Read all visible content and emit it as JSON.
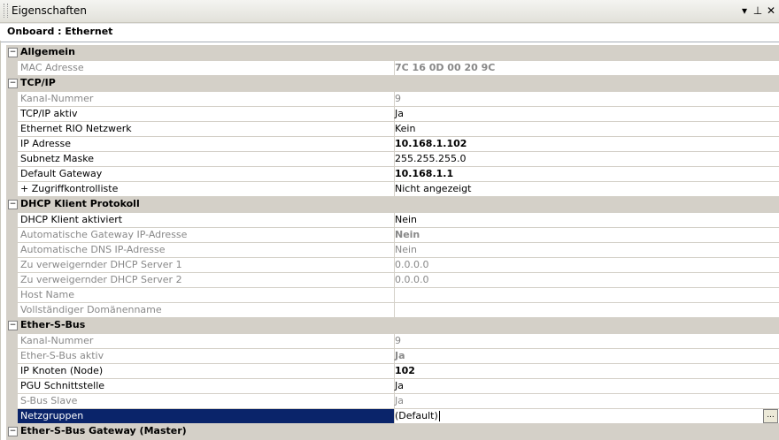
{
  "panel": {
    "title": "Eigenschaften",
    "icons": [
      "dropdown-arrow-icon",
      "pin-icon",
      "close-icon"
    ]
  },
  "object_selector": {
    "value": "Onboard : Ethernet"
  },
  "categories": [
    {
      "label": "Allgemein",
      "props": [
        {
          "name": "MAC Adresse",
          "value": "7C 16 0D 00 20 9C",
          "disabled": true,
          "bold": true
        }
      ]
    },
    {
      "label": "TCP/IP",
      "props": [
        {
          "name": "Kanal-Nummer",
          "value": "9",
          "disabled": true
        },
        {
          "name": "TCP/IP aktiv",
          "value": "Ja"
        },
        {
          "name": "Ethernet RIO Netzwerk",
          "value": "Kein"
        },
        {
          "name": "IP Adresse",
          "value": "10.168.1.102",
          "bold": true
        },
        {
          "name": "Subnetz Maske",
          "value": "255.255.255.0"
        },
        {
          "name": "Default Gateway",
          "value": "10.168.1.1",
          "bold": true
        },
        {
          "name": "+ Zugriffkontrolliste",
          "value": "Nicht angezeigt"
        }
      ]
    },
    {
      "label": "DHCP Klient Protokoll",
      "props": [
        {
          "name": "DHCP Klient aktiviert",
          "value": "Nein"
        },
        {
          "name": "Automatische Gateway IP-Adresse",
          "value": "Nein",
          "disabled": true,
          "bold": true
        },
        {
          "name": "Automatische DNS IP-Adresse",
          "value": "Nein",
          "disabled": true
        },
        {
          "name": "Zu verweigernder DHCP Server 1",
          "value": "0.0.0.0",
          "disabled": true
        },
        {
          "name": "Zu verweigernder DHCP Server 2",
          "value": "0.0.0.0",
          "disabled": true
        },
        {
          "name": "Host Name",
          "value": "",
          "disabled": true
        },
        {
          "name": "Vollständiger Domänenname",
          "value": "",
          "disabled": true
        }
      ]
    },
    {
      "label": "Ether-S-Bus",
      "props": [
        {
          "name": "Kanal-Nummer",
          "value": "9",
          "disabled": true
        },
        {
          "name": "Ether-S-Bus aktiv",
          "value": "Ja",
          "disabled": true,
          "bold": true
        },
        {
          "name": "IP Knoten (Node)",
          "value": "102",
          "bold": true
        },
        {
          "name": "PGU Schnittstelle",
          "value": "Ja"
        },
        {
          "name": "S-Bus Slave",
          "value": "Ja",
          "disabled": true
        },
        {
          "name": "Netzgruppen",
          "value": "(Default)",
          "selected": true,
          "ellipsis": "..."
        }
      ]
    },
    {
      "label": "Ether-S-Bus Gateway (Master)",
      "props": []
    }
  ]
}
